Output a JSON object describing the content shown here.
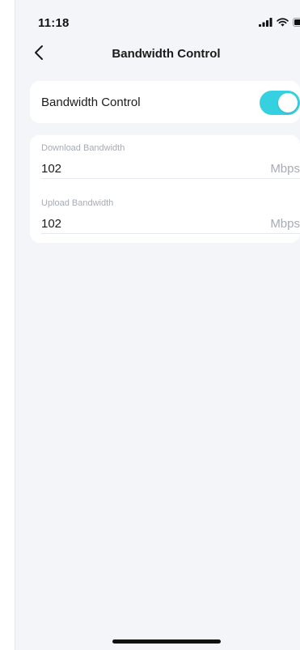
{
  "status_bar": {
    "time": "11:18",
    "icons": [
      "signal-icon",
      "wifi-icon",
      "battery-icon"
    ]
  },
  "nav": {
    "back_icon": "chevron-left-icon",
    "title": "Bandwidth Control"
  },
  "bandwidth_toggle": {
    "label": "Bandwidth Control",
    "enabled": true,
    "accent_color": "#36d1e0"
  },
  "fields": {
    "download": {
      "label": "Download Bandwidth",
      "value": "102",
      "unit": "Mbps"
    },
    "upload": {
      "label": "Upload Bandwidth",
      "value": "102",
      "unit": "Mbps"
    }
  },
  "colors": {
    "background": "#f4f5f9",
    "card": "#ffffff",
    "muted_text": "#a7abb5"
  }
}
